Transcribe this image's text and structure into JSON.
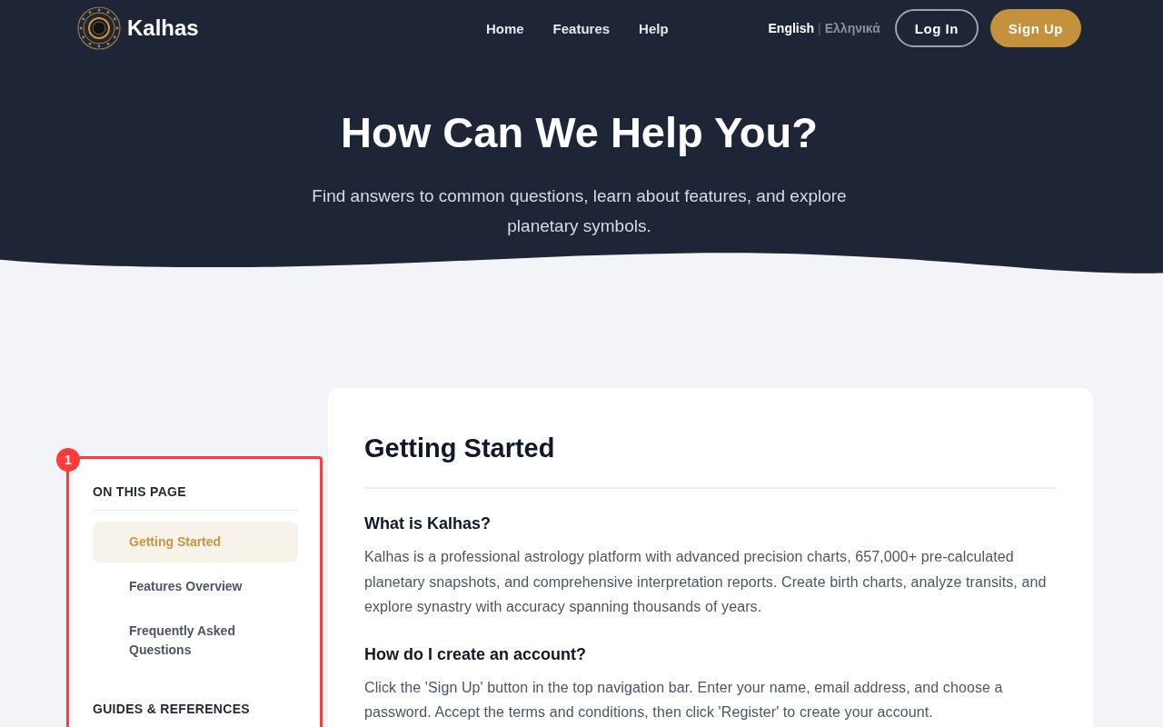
{
  "brand": {
    "name": "Kalhas"
  },
  "nav": [
    {
      "label": "Home"
    },
    {
      "label": "Features"
    },
    {
      "label": "Help"
    }
  ],
  "languages": [
    {
      "label": "English",
      "selected": true
    },
    {
      "label": "Ελληνικά",
      "selected": false
    }
  ],
  "language_separator": "|",
  "auth_buttons": [
    {
      "label": "Log In",
      "kind": "outline"
    },
    {
      "label": "Sign Up",
      "kind": "filled"
    }
  ],
  "hero": {
    "title": "How Can We Help You?",
    "subtitle": "Find answers to common questions, learn about features, and explore planetary symbols."
  },
  "sidebar": {
    "annotation": "1",
    "sections": [
      {
        "heading": "ON THIS PAGE",
        "items": [
          {
            "label": "Getting Started",
            "selected": true
          },
          {
            "label": "Features Overview",
            "selected": false
          },
          {
            "label": "Frequently Asked Questions",
            "selected": false
          }
        ]
      },
      {
        "heading": "GUIDES & REFERENCES"
      }
    ]
  },
  "content": {
    "title": "Getting Started",
    "blocks": [
      {
        "kind": "question",
        "text": "What is Kalhas?"
      },
      {
        "kind": "answer",
        "text": "Kalhas is a professional astrology platform with advanced precision charts, 657,000+ pre-calculated planetary snapshots, and comprehensive interpretation reports. Create birth charts, analyze transits, and explore synastry with accuracy spanning thousands of years."
      },
      {
        "kind": "question",
        "text": "How do I create an account?"
      },
      {
        "kind": "answer",
        "text": "Click the 'Sign Up' button in the top navigation bar. Enter your name, email address, and choose a password. Accept the terms and conditions, then click 'Register' to create your account."
      }
    ]
  }
}
